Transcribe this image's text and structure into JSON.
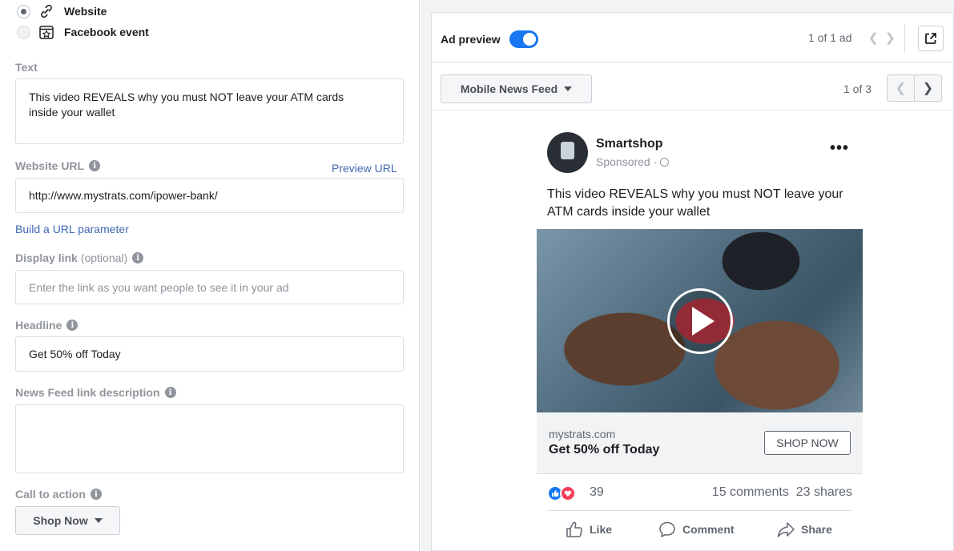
{
  "destination": {
    "options": [
      {
        "label": "Website",
        "selected": true,
        "icon": "link-icon"
      },
      {
        "label": "Facebook event",
        "selected": false,
        "icon": "event-star-icon"
      }
    ]
  },
  "form": {
    "text_label": "Text",
    "text_value": "This video REVEALS why you must NOT leave your ATM cards inside your wallet",
    "website_url_label": "Website URL",
    "preview_url_link": "Preview URL",
    "website_url_value": "http://www.mystrats.com/ipower-bank/",
    "build_url_link": "Build a URL parameter",
    "display_link_label": "Display link",
    "display_link_optional": "(optional)",
    "display_link_placeholder": "Enter the link as you want people to see it in your ad",
    "headline_label": "Headline",
    "headline_value": "Get 50% off Today",
    "news_feed_desc_label": "News Feed link description",
    "news_feed_desc_value": "",
    "cta_label": "Call to action",
    "cta_value": "Shop Now"
  },
  "preview": {
    "title": "Ad preview",
    "toggle_on": true,
    "ad_count": "1 of 1 ad",
    "placement": "Mobile News Feed",
    "placement_count": "1 of 3",
    "post": {
      "page_name": "Smartshop",
      "sponsored": "Sponsored ·",
      "text": "This video REVEALS why you must NOT leave your ATM cards inside your wallet",
      "link_domain": "mystrats.com",
      "link_headline": "Get 50% off Today",
      "cta_button": "SHOP NOW",
      "reaction_count": "39",
      "comments": "15 comments",
      "shares": "23 shares",
      "actions": {
        "like": "Like",
        "comment": "Comment",
        "share": "Share"
      }
    }
  },
  "colors": {
    "accent": "#1877f2",
    "link": "#4267b2",
    "love": "#f33e58"
  }
}
